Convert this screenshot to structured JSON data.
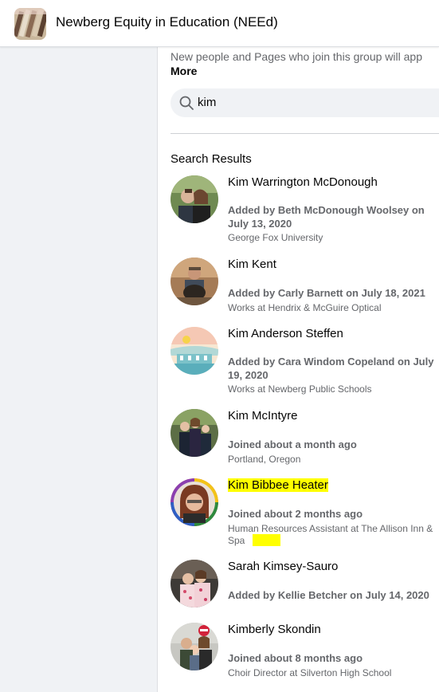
{
  "header": {
    "group_name": "Newberg Equity in Education (NEEd)"
  },
  "main": {
    "intro_text": "New people and Pages who join this group will app",
    "more_label": "More",
    "search": {
      "value": "kim"
    },
    "results_title": "Search Results",
    "results": [
      {
        "name": "Kim Warrington McDonough",
        "added": "Added by Beth McDonough Woolsey on July 13, 2020",
        "sub": "George Fox University"
      },
      {
        "name": "Kim Kent",
        "added": "Added by Carly Barnett on July 18, 2021",
        "sub": "Works at Hendrix & McGuire Optical"
      },
      {
        "name": "Kim Anderson Steffen",
        "added": "Added by Cara Windom Copeland on July 19, 2020",
        "sub": "Works at Newberg Public Schools"
      },
      {
        "name": "Kim McIntyre",
        "added": "Joined about a month ago",
        "sub": "Portland, Oregon"
      },
      {
        "name": "Kim Bibbee Heater",
        "added": "Joined about 2 months ago",
        "sub": "Human Resources Assistant at The Allison Inn & Spa"
      },
      {
        "name": "Sarah Kimsey-Sauro",
        "added": "Added by Kellie Betcher on July 14, 2020",
        "sub": ""
      },
      {
        "name": "Kimberly Skondin",
        "added": "Joined about 8 months ago",
        "sub": "Choir Director at Silverton High School"
      }
    ]
  },
  "colors": {
    "highlight": "#ffff00",
    "secondary_text": "#65676b",
    "page_bg": "#f0f2f5"
  }
}
